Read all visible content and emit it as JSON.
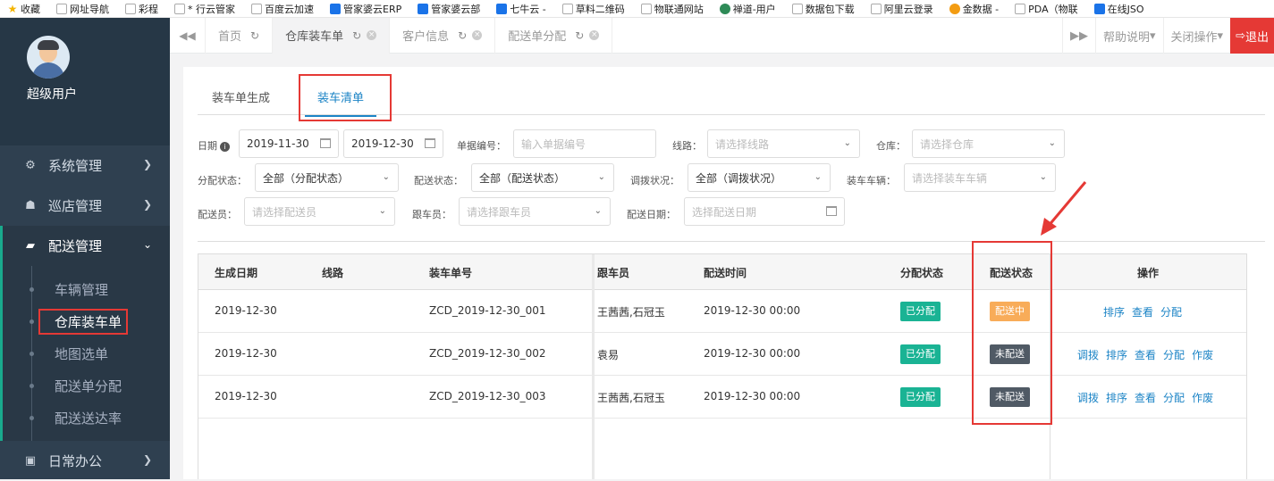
{
  "bookmarks": [
    {
      "label": "收藏",
      "icon": "star-icon"
    },
    {
      "label": "网址导航",
      "icon": "globe-icon"
    },
    {
      "label": "彩程",
      "icon": "page-icon"
    },
    {
      "label": "* 行云管家",
      "icon": "page-icon"
    },
    {
      "label": "百度云加速",
      "icon": "page-icon"
    },
    {
      "label": "管家婆云ERP",
      "icon": "app-icon"
    },
    {
      "label": "管家婆云部",
      "icon": "app-icon"
    },
    {
      "label": "七牛云 -",
      "icon": "cloud-icon"
    },
    {
      "label": "草料二维码",
      "icon": "page-icon"
    },
    {
      "label": "物联通网站",
      "icon": "page-icon"
    },
    {
      "label": "禅道-用户",
      "icon": "app-icon"
    },
    {
      "label": "数据包下载",
      "icon": "page-icon"
    },
    {
      "label": "阿里云登录",
      "icon": "page-icon"
    },
    {
      "label": "金数据 -",
      "icon": "flower-icon"
    },
    {
      "label": "PDA（物联",
      "icon": "page-icon"
    },
    {
      "label": "在线JSO",
      "icon": "code-icon"
    }
  ],
  "user": {
    "name": "超级用户"
  },
  "nav": {
    "system": "系统管理",
    "patrol": "巡店管理",
    "delivery": "配送管理",
    "daily": "日常办公",
    "sub": [
      "车辆管理",
      "仓库装车单",
      "地图选单",
      "配送单分配",
      "配送送达率"
    ]
  },
  "topbar": {
    "tabs": [
      "首页",
      "仓库装车单",
      "客户信息",
      "配送单分配"
    ],
    "help": "帮助说明",
    "close_ops": "关闭操作",
    "exit": "退出"
  },
  "subtabs": {
    "generate": "装车单生成",
    "list": "装车清单"
  },
  "filters": {
    "date_label": "日期",
    "date_from": "2019-11-30",
    "date_to": "2019-12-30",
    "doc_no_label": "单据编号：",
    "doc_no_placeholder": "输入单据编号",
    "route_label": "线路：",
    "route_placeholder": "请选择线路",
    "warehouse_label": "仓库：",
    "warehouse_placeholder": "请选择仓库",
    "assign_label": "分配状态：",
    "assign_value": "全部（分配状态）",
    "delivery_label": "配送状态：",
    "delivery_value": "全部（配送状态）",
    "transfer_label": "调拨状况：",
    "transfer_value": "全部（调拨状况）",
    "vehicle_label": "装车车辆：",
    "vehicle_placeholder": "请选择装车车辆",
    "courier_label": "配送员：",
    "courier_placeholder": "请选择配送员",
    "follower_label": "跟车员：",
    "follower_placeholder": "请选择跟车员",
    "ddate_label": "配送日期：",
    "ddate_placeholder": "选择配送日期"
  },
  "table": {
    "headers": [
      "生成日期",
      "线路",
      "装车单号",
      "跟车员",
      "配送时间",
      "分配状态",
      "配送状态",
      "操作"
    ],
    "rows": [
      {
        "date": "2019-12-30",
        "route": "",
        "no": "ZCD_2019-12-30_001",
        "follower": "王茜茜,石冠玉",
        "time": "2019-12-30 00:00",
        "assign": "已分配",
        "delivery": "配送中",
        "ops": [
          "排序",
          "查看",
          "分配"
        ]
      },
      {
        "date": "2019-12-30",
        "route": "",
        "no": "ZCD_2019-12-30_002",
        "follower": "袁易",
        "time": "2019-12-30 00:00",
        "assign": "已分配",
        "delivery": "未配送",
        "ops": [
          "调拨",
          "排序",
          "查看",
          "分配",
          "作废"
        ]
      },
      {
        "date": "2019-12-30",
        "route": "",
        "no": "ZCD_2019-12-30_003",
        "follower": "王茜茜,石冠玉",
        "time": "2019-12-30 00:00",
        "assign": "已分配",
        "delivery": "未配送",
        "ops": [
          "调拨",
          "排序",
          "查看",
          "分配",
          "作废"
        ]
      }
    ]
  },
  "colors": {
    "sidebar": "#2f4050",
    "accent": "#1c84c6",
    "green": "#1ab394",
    "orange": "#f8ac59",
    "dark": "#505a65",
    "highlight": "#e53935"
  }
}
